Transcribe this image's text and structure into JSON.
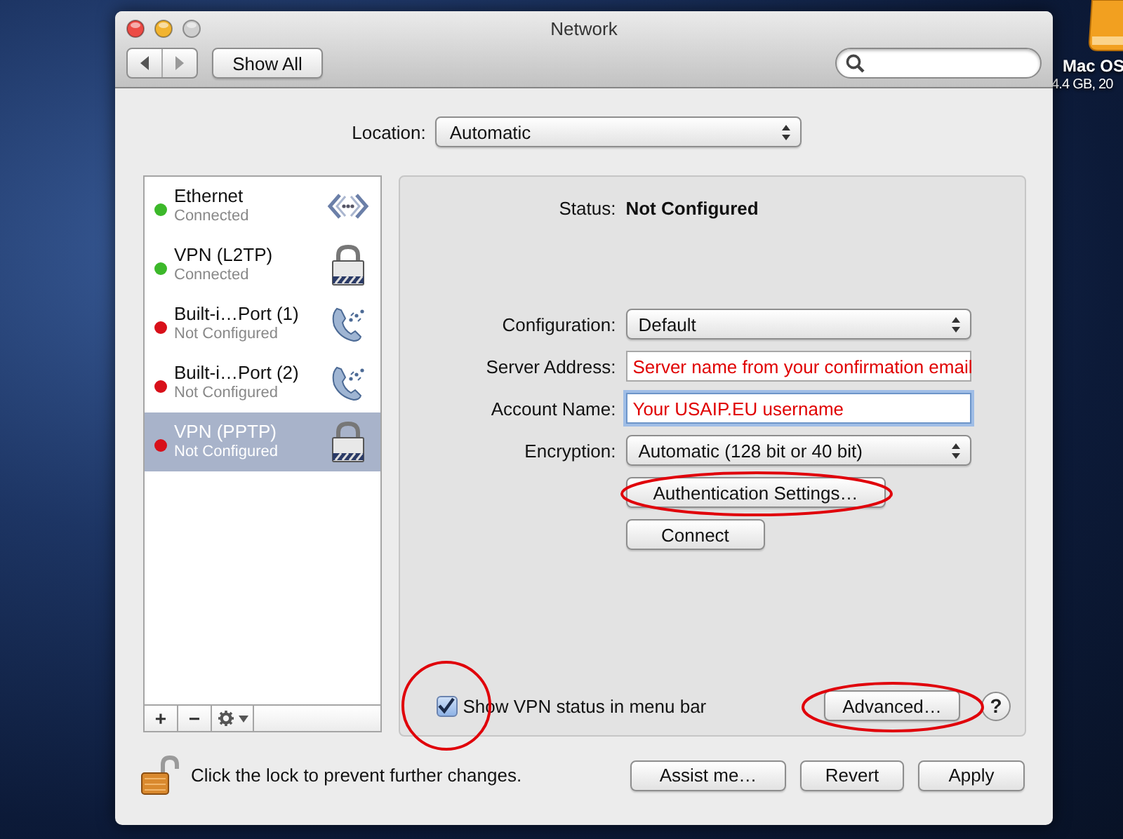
{
  "desktop": {
    "disk_icon": {
      "name": "Mac OS",
      "info": "4.4 GB, 20"
    }
  },
  "window": {
    "title": "Network"
  },
  "toolbar": {
    "show_all": "Show All"
  },
  "location": {
    "label": "Location:",
    "value": "Automatic"
  },
  "services": [
    {
      "name": "Ethernet",
      "status": "Connected",
      "color": "#3cb82a",
      "kind": "ethernet",
      "selected": false
    },
    {
      "name": "VPN (L2TP)",
      "status": "Connected",
      "color": "#3cb82a",
      "kind": "vpn",
      "selected": false
    },
    {
      "name": "Built-i…Port (1)",
      "status": "Not Configured",
      "color": "#d8101a",
      "kind": "modem",
      "selected": false
    },
    {
      "name": "Built-i…Port (2)",
      "status": "Not Configured",
      "color": "#d8101a",
      "kind": "modem",
      "selected": false
    },
    {
      "name": "VPN (PPTP)",
      "status": "Not Configured",
      "color": "#d8101a",
      "kind": "vpn",
      "selected": true
    }
  ],
  "list_buttons": [
    "+",
    "−"
  ],
  "detail": {
    "status": {
      "label": "Status:",
      "value": "Not Configured"
    },
    "fields": [
      {
        "kind": "popup",
        "label": "Configuration:",
        "value": "Default"
      },
      {
        "kind": "text",
        "label": "Server Address:",
        "value": "Server name from your confirmation email",
        "focused": false
      },
      {
        "kind": "text",
        "label": "Account Name:",
        "value": "Your USAIP.EU username",
        "focused": true
      },
      {
        "kind": "popup",
        "label": "Encryption:",
        "value": "Automatic (128 bit or 40 bit)"
      }
    ],
    "buttons": [
      "Authentication Settings…",
      "Connect"
    ],
    "show_status": {
      "label": "Show VPN status in menu bar",
      "checked": true
    },
    "advanced": "Advanced…",
    "help": "?"
  },
  "footer": {
    "lock_text": "Click the lock to prevent further changes.",
    "buttons": [
      "Assist me…",
      "Revert",
      "Apply"
    ]
  }
}
